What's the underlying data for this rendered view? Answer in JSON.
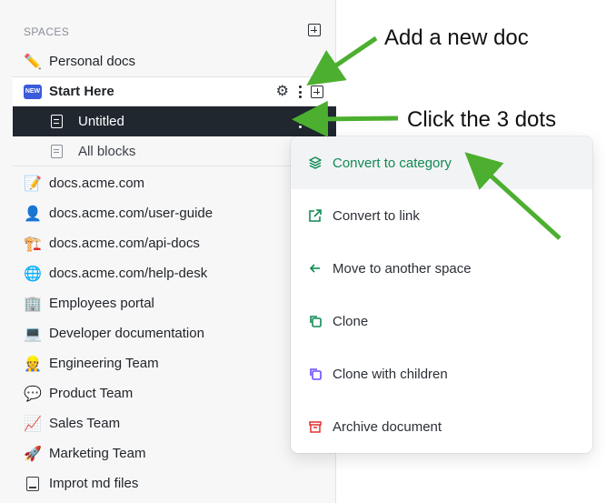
{
  "sidebar": {
    "spaces_label": "SPACES",
    "items": [
      {
        "label": "Personal docs",
        "icon": "pencil-emoji"
      },
      {
        "label": "Start Here",
        "icon": "new-badge",
        "badge": "NEW"
      },
      {
        "label": "Untitled",
        "icon": "document-icon"
      },
      {
        "label": "All blocks",
        "icon": "document-icon"
      },
      {
        "label": "docs.acme.com",
        "icon": "memo-emoji"
      },
      {
        "label": "docs.acme.com/user-guide",
        "icon": "person-emoji"
      },
      {
        "label": "docs.acme.com/api-docs",
        "icon": "construction-emoji"
      },
      {
        "label": "docs.acme.com/help-desk",
        "icon": "globe-emoji"
      },
      {
        "label": "Employees portal",
        "icon": "office-emoji"
      },
      {
        "label": "Developer documentation",
        "icon": "laptop-emoji"
      },
      {
        "label": "Engineering Team",
        "icon": "worker-emoji"
      },
      {
        "label": "Product Team",
        "icon": "speech-bubble-emoji"
      },
      {
        "label": "Sales Team",
        "icon": "chart-emoji"
      },
      {
        "label": "Marketing Team",
        "icon": "rocket-emoji"
      },
      {
        "label": "Improt md files",
        "icon": "tablet-icon"
      }
    ]
  },
  "menu": {
    "items": [
      {
        "label": "Convert to category",
        "icon": "layers-icon",
        "color": "#0f8a52"
      },
      {
        "label": "Convert to link",
        "icon": "external-link-icon",
        "color": "#0f8a52"
      },
      {
        "label": "Move to another space",
        "icon": "arrow-left-icon",
        "color": "#0f8a52"
      },
      {
        "label": "Clone",
        "icon": "clone-icon",
        "color": "#0f8a52"
      },
      {
        "label": "Clone with children",
        "icon": "clone-icon",
        "color": "#6a4cff"
      },
      {
        "label": "Archive document",
        "icon": "archive-icon",
        "color": "#e03131"
      }
    ]
  },
  "annotations": {
    "add_doc": "Add a new doc",
    "click_dots": "Click the 3 dots"
  },
  "colors": {
    "arrow_green": "#4caf2f",
    "accent_green": "#0f8a52",
    "selected_row": "#20272f"
  }
}
